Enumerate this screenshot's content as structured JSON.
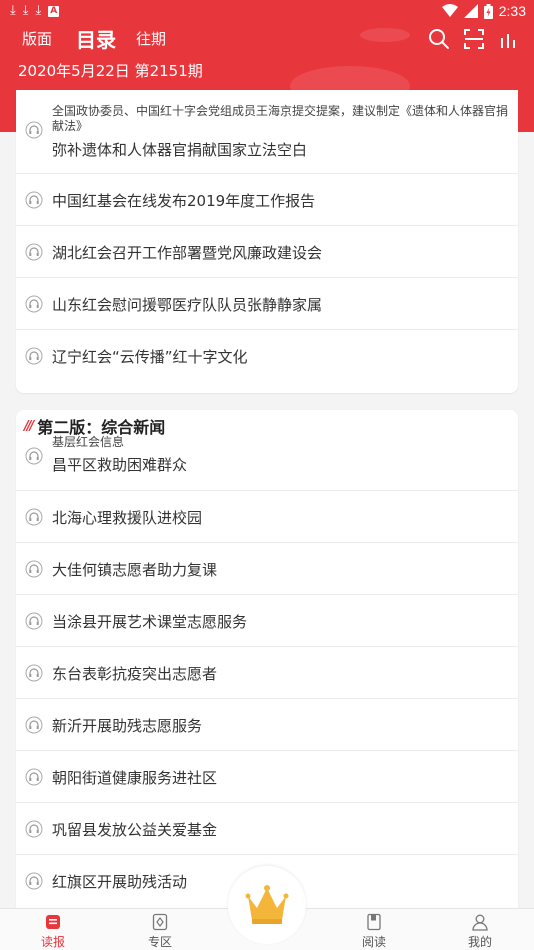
{
  "status_bar": {
    "time": "2:33"
  },
  "nav": {
    "tabs": [
      "版面",
      "目录",
      "往期"
    ],
    "active_tab": "目录",
    "icons": [
      "search-icon",
      "scan-icon",
      "chart-icon"
    ]
  },
  "issue": {
    "date_label": "2020年5月22日 第2151期"
  },
  "section1": {
    "items": [
      {
        "subtitle": "全国政协委员、中国红十字会党组成员王海京提交提案，建议制定《遗体和人体器官捐献法》",
        "title": "弥补遗体和人体器官捐献国家立法空白"
      },
      {
        "title": "中国红基会在线发布2019年度工作报告"
      },
      {
        "title": "湖北红会召开工作部署暨党风廉政建设会"
      },
      {
        "title": "山东红会慰问援鄂医疗队队员张静静家属"
      },
      {
        "title": "辽宁红会“云传播”红十字文化"
      }
    ]
  },
  "section2": {
    "mark": "///",
    "heading": "第二版：综合新闻",
    "items": [
      {
        "subtitle": "基层红会信息",
        "title": "昌平区救助困难群众"
      },
      {
        "title": "北海心理救援队进校园"
      },
      {
        "title": "大佳何镇志愿者助力复课"
      },
      {
        "title": "当涂县开展艺术课堂志愿服务"
      },
      {
        "title": "东台表彰抗疫突出志愿者"
      },
      {
        "title": "新沂开展助残志愿服务"
      },
      {
        "title": "朝阳街道健康服务进社区"
      },
      {
        "title": "巩留县发放公益关爱基金"
      },
      {
        "title": "红旗区开展助残活动"
      }
    ]
  },
  "bottom_nav": {
    "items": [
      {
        "label": "读报",
        "icon": "newspaper-icon",
        "active": true
      },
      {
        "label": "专区",
        "icon": "zone-icon"
      },
      {
        "label": "阅读",
        "icon": "book-icon"
      },
      {
        "label": "我的",
        "icon": "user-icon"
      }
    ],
    "center_icon": "crown-icon"
  },
  "colors": {
    "brand_red": "#e8363d",
    "crown_gold": "#f3b63b"
  }
}
